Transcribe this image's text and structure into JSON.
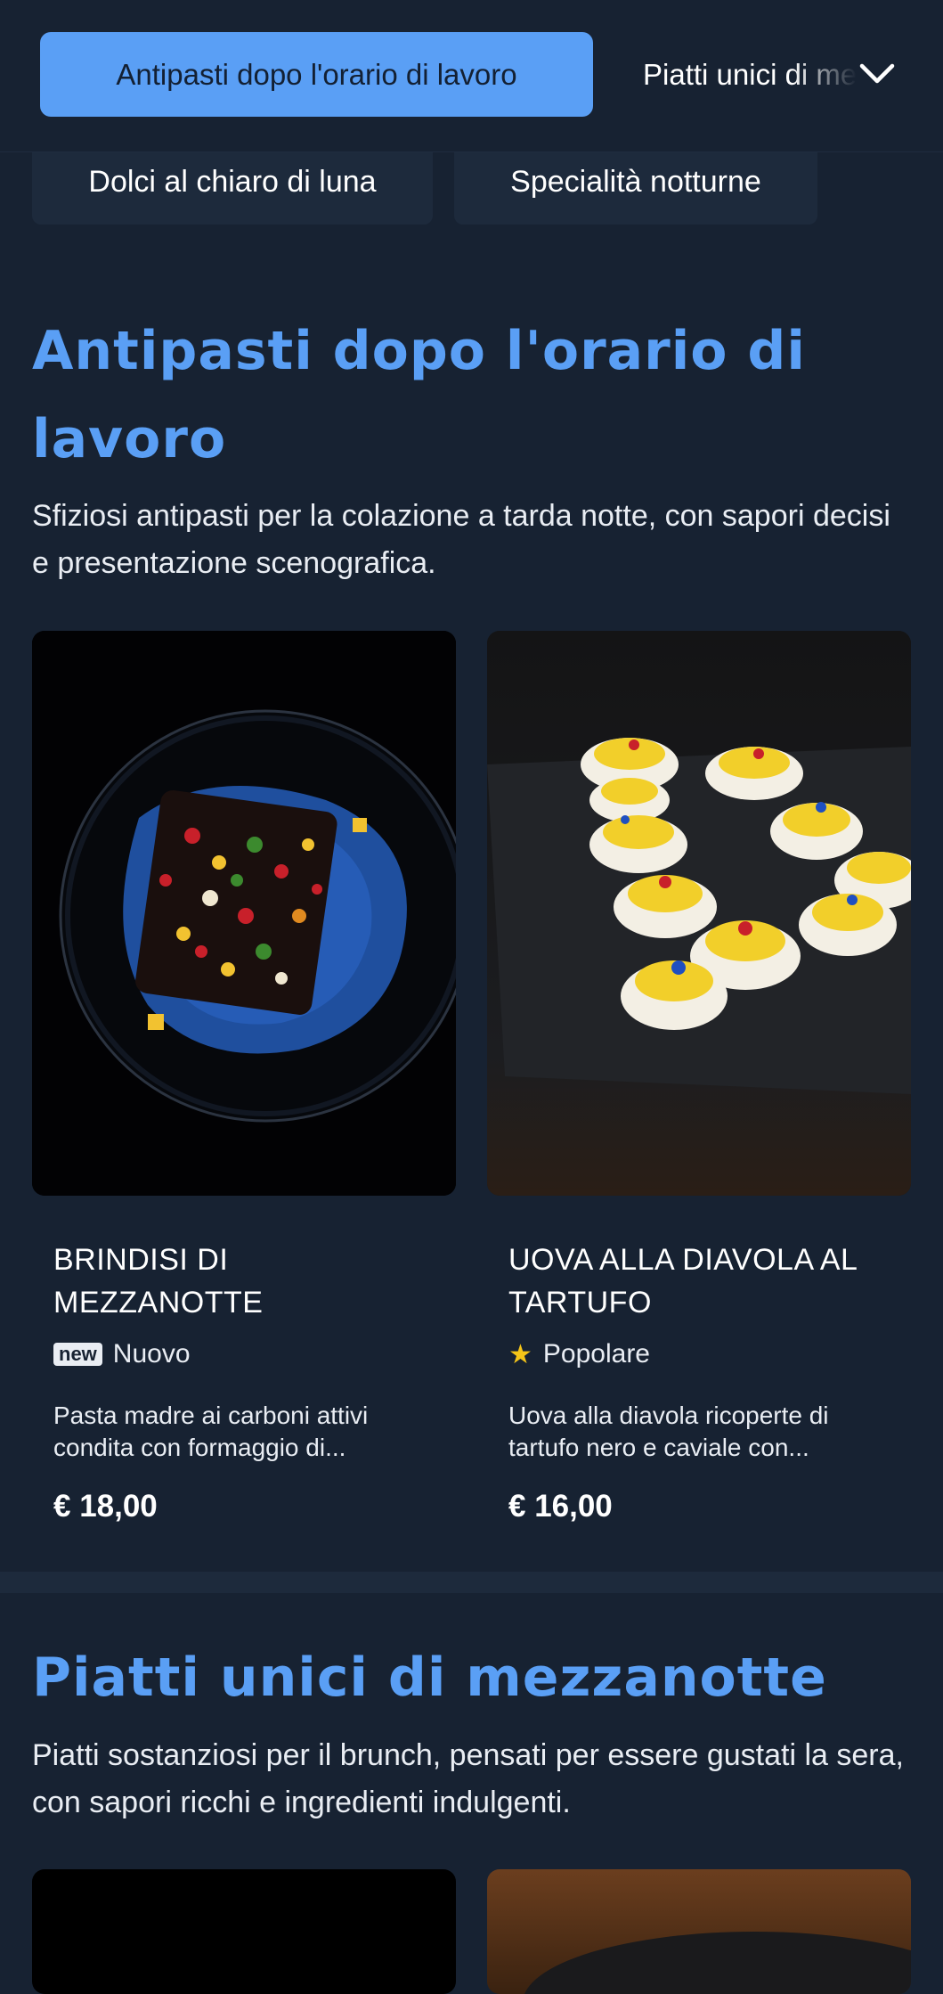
{
  "tabs": {
    "active": "Antipasti dopo l'orario di lavoro",
    "next": "Piatti unici di mezzanotte",
    "row2": [
      "Dolci al chiaro di luna",
      "Specialità notturne"
    ]
  },
  "sections": [
    {
      "title": "Antipasti dopo l'orario di lavoro",
      "description": "Sfiziosi antipasti per la colazione a tarda notte, con sapori decisi e presentazione scenografica.",
      "items": [
        {
          "name": "BRINDISI DI MEZZANOTTE",
          "badge_icon": "new",
          "badge_label": "Nuovo",
          "description": "Pasta madre ai carboni attivi condita con formaggio di...",
          "price": "€ 18,00"
        },
        {
          "name": "UOVA ALLA DIAVOLA AL TARTUFO",
          "badge_icon": "star-icon",
          "badge_label": "Popolare",
          "description": "Uova alla diavola ricoperte di tartufo nero e caviale con...",
          "price": "€ 16,00"
        }
      ]
    },
    {
      "title": "Piatti unici di mezzanotte",
      "description": "Piatti sostanziosi per il brunch, pensati per essere gustati la sera, con sapori ricchi e ingredienti indulgenti."
    }
  ],
  "colors": {
    "background": "#172232",
    "accent": "#5a9ff5",
    "star": "#f5c518"
  }
}
